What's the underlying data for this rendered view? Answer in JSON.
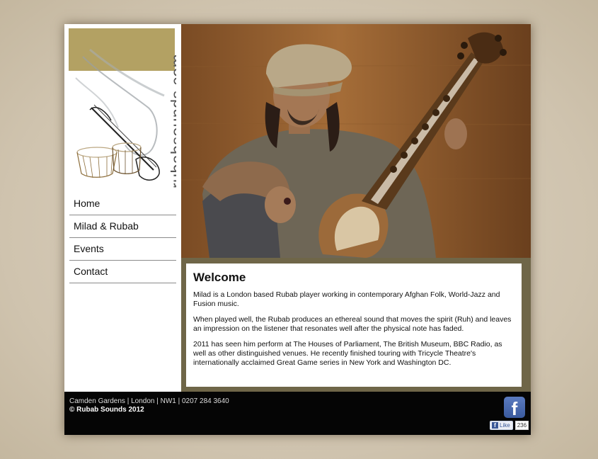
{
  "brand": {
    "logo_text": "rubabsounds.com",
    "band_color": "#b3a163"
  },
  "nav": {
    "items": [
      {
        "label": "Home"
      },
      {
        "label": "Milad & Rubab"
      },
      {
        "label": "Events"
      },
      {
        "label": "Contact"
      }
    ]
  },
  "hero": {
    "image_icon": "musician-photo"
  },
  "content": {
    "title": "Welcome",
    "paragraphs": [
      "Milad is a London based Rubab player working in contemporary Afghan Folk, World-Jazz and Fusion music.",
      "When played well, the Rubab produces an ethereal sound that moves the spirit (Ruh) and leaves an impression on the listener that resonates well after the physical note has faded.",
      "2011 has seen him perform at The Houses of Parliament, The British Museum, BBC Radio, as well as other distinguished venues. He recently finished touring with Tricycle Theatre's internationally acclaimed Great Game series in New York and Washington DC."
    ]
  },
  "footer": {
    "address": "Camden Gardens | London | NW1 | 0207 284 3640",
    "copyright": "© Rubab Sounds 2012",
    "facebook_icon": "f",
    "like_label": "Like",
    "like_count": "236"
  },
  "colors": {
    "content_border": "#6f6648",
    "footer_bg": "#050505",
    "facebook": "#3b5998"
  }
}
